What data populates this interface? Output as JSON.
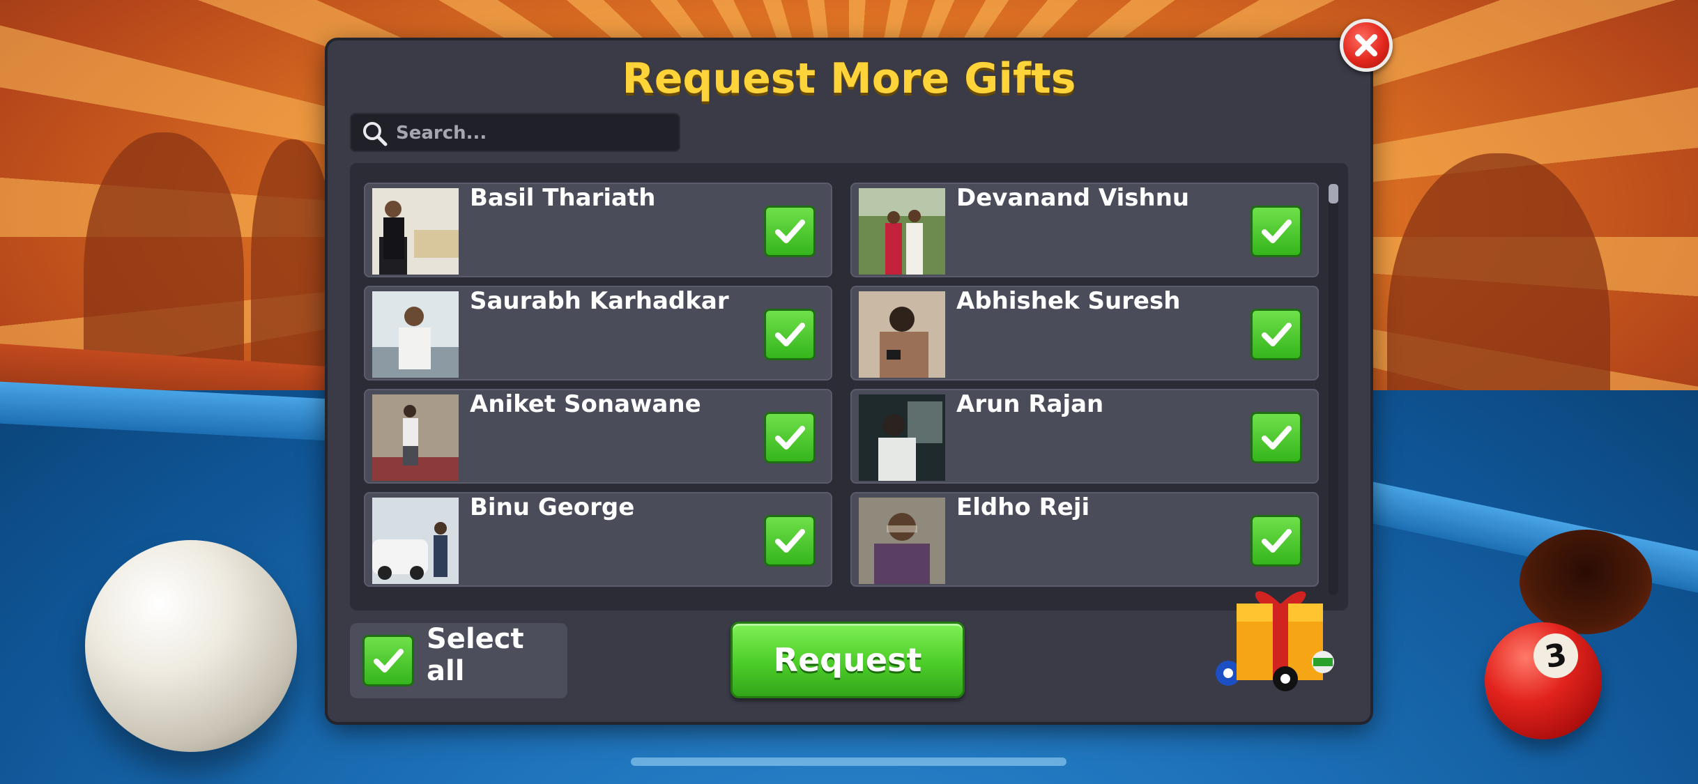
{
  "dialog": {
    "title": "Request More Gifts"
  },
  "search": {
    "placeholder": "Search..."
  },
  "friends": [
    {
      "name": "Basil Thariath",
      "checked": true
    },
    {
      "name": "Devanand Vishnu",
      "checked": true
    },
    {
      "name": "Saurabh Karhadkar",
      "checked": true
    },
    {
      "name": "Abhishek Suresh",
      "checked": true
    },
    {
      "name": "Aniket Sonawane",
      "checked": true
    },
    {
      "name": "Arun Rajan",
      "checked": true
    },
    {
      "name": "Binu George",
      "checked": true
    },
    {
      "name": "Eldho Reji",
      "checked": true
    }
  ],
  "footer": {
    "select_all_label": "Select all",
    "select_all_checked": true,
    "request_label": "Request"
  },
  "decor": {
    "ball_number": "3"
  },
  "colors": {
    "title": "#ffd33a",
    "check_green": "#4ccd29",
    "close_red": "#e2271d",
    "panel": "#3a3b47"
  }
}
